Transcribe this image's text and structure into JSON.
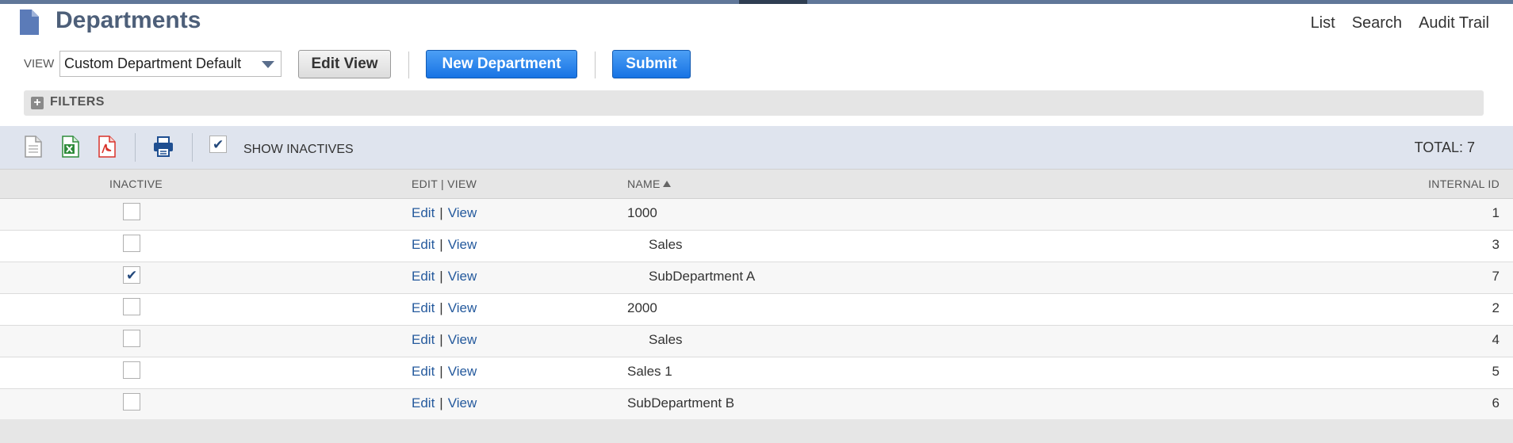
{
  "page": {
    "title": "Departments",
    "header_links": [
      "List",
      "Search",
      "Audit Trail"
    ]
  },
  "view_bar": {
    "view_label": "VIEW",
    "view_value": "Custom Department Default",
    "edit_view_label": "Edit View",
    "new_department_label": "New Department",
    "submit_label": "Submit"
  },
  "filters": {
    "label": "FILTERS"
  },
  "toolbar": {
    "icons": [
      "export-csv-icon",
      "export-excel-icon",
      "export-pdf-icon",
      "print-icon"
    ],
    "show_inactives_label": "SHOW INACTIVES",
    "show_inactives_checked": true,
    "total_label": "TOTAL: 7"
  },
  "table": {
    "columns": [
      "INACTIVE",
      "EDIT | VIEW",
      "NAME",
      "INTERNAL ID"
    ],
    "sort_column": "NAME",
    "edit_label": "Edit",
    "separator": "|",
    "view_label": "View",
    "rows": [
      {
        "inactive": false,
        "name": "1000",
        "indent": 0,
        "internal_id": "1"
      },
      {
        "inactive": false,
        "name": "Sales",
        "indent": 1,
        "internal_id": "3"
      },
      {
        "inactive": true,
        "name": "SubDepartment A",
        "indent": 1,
        "internal_id": "7"
      },
      {
        "inactive": false,
        "name": "2000",
        "indent": 0,
        "internal_id": "2"
      },
      {
        "inactive": false,
        "name": "Sales",
        "indent": 1,
        "internal_id": "4"
      },
      {
        "inactive": false,
        "name": "Sales 1",
        "indent": 0,
        "internal_id": "5"
      },
      {
        "inactive": false,
        "name": "SubDepartment B",
        "indent": 0,
        "internal_id": "6"
      }
    ]
  },
  "colors": {
    "title": "#4d5f79",
    "link": "#255a9d",
    "primary_button": "#1773e4",
    "toolbar_bg": "#dfe4ee",
    "check": "#24497c"
  }
}
